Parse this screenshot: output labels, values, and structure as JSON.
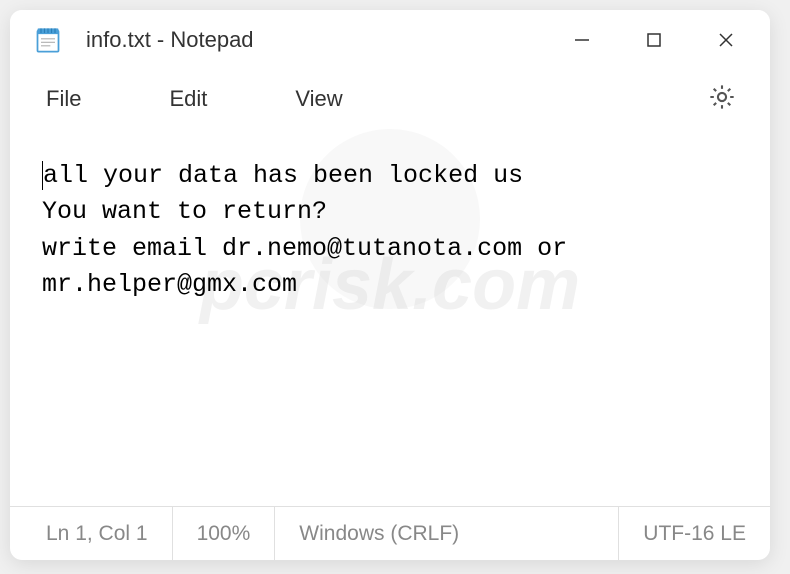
{
  "window": {
    "title": "info.txt - Notepad"
  },
  "menu": {
    "file": "File",
    "edit": "Edit",
    "view": "View"
  },
  "content": {
    "text": "all your data has been locked us\nYou want to return?\nwrite email dr.nemo@tutanota.com or mr.helper@gmx.com"
  },
  "statusbar": {
    "position": "Ln 1, Col 1",
    "zoom": "100%",
    "line_ending": "Windows (CRLF)",
    "encoding": "UTF-16 LE"
  },
  "watermark": {
    "text": "pcrisk.com"
  }
}
